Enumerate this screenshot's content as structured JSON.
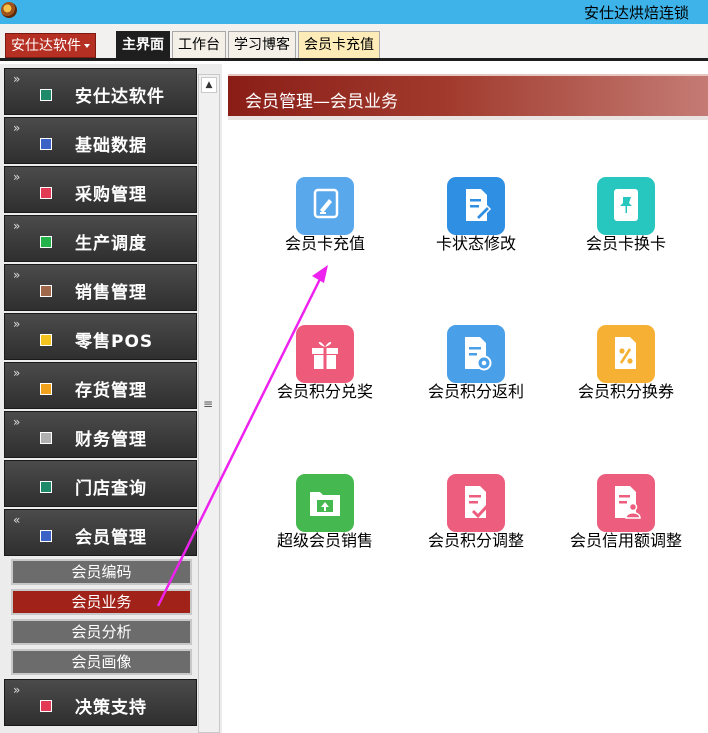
{
  "window": {
    "title": "安仕达烘焙连锁"
  },
  "menubar": {
    "app_menu": "安仕达软件",
    "tabs": [
      {
        "label": "主界面",
        "active": true
      },
      {
        "label": "工作台"
      },
      {
        "label": "学习博客"
      },
      {
        "label": "会员卡充值",
        "selected": true
      }
    ]
  },
  "sidebar": {
    "items": [
      {
        "label": "安仕达软件",
        "color": "#1f8a6a"
      },
      {
        "label": "基础数据",
        "color": "#3b62c4"
      },
      {
        "label": "采购管理",
        "color": "#e23a55"
      },
      {
        "label": "生产调度",
        "color": "#24b34a"
      },
      {
        "label": "销售管理",
        "color": "#a0684a"
      },
      {
        "label": "零售POS",
        "color": "#f5c31d"
      },
      {
        "label": "存货管理",
        "color": "#f0a21c"
      },
      {
        "label": "财务管理",
        "color": "#b0b0b0"
      },
      {
        "label": "门店查询",
        "color": "#1f8a6a"
      },
      {
        "label": "会员管理",
        "color": "#3b62c4"
      }
    ],
    "submenu": [
      {
        "label": "会员编码"
      },
      {
        "label": "会员业务",
        "active": true
      },
      {
        "label": "会员分析"
      },
      {
        "label": "会员画像"
      }
    ],
    "last_item": {
      "label": "决策支持",
      "color": "#e23a55"
    }
  },
  "panel": {
    "title": "会员管理—会员业务",
    "tiles": [
      {
        "label": "会员卡充值",
        "icon": "card-recharge-icon",
        "color": "#5aa8ec"
      },
      {
        "label": "卡状态修改",
        "icon": "document-edit-icon",
        "color": "#2f8fe3"
      },
      {
        "label": "会员卡换卡",
        "icon": "card-pin-icon",
        "color": "#27c6be"
      },
      {
        "label": "会员积分兑奖",
        "icon": "gift-icon",
        "color": "#ee5a7a"
      },
      {
        "label": "会员积分返利",
        "icon": "document-gear-icon",
        "color": "#4a9fe9"
      },
      {
        "label": "会员积分换券",
        "icon": "percent-coupon-icon",
        "color": "#f6b135"
      },
      {
        "label": "超级会员销售",
        "icon": "folder-upload-icon",
        "color": "#45b84f"
      },
      {
        "label": "会员积分调整",
        "icon": "document-check-icon",
        "color": "#ec5d7e"
      },
      {
        "label": "会员信用额调整",
        "icon": "document-user-icon",
        "color": "#ec5d7e"
      }
    ]
  },
  "colors": {
    "accent": "#a12218",
    "arrow": "#ee22ee"
  }
}
